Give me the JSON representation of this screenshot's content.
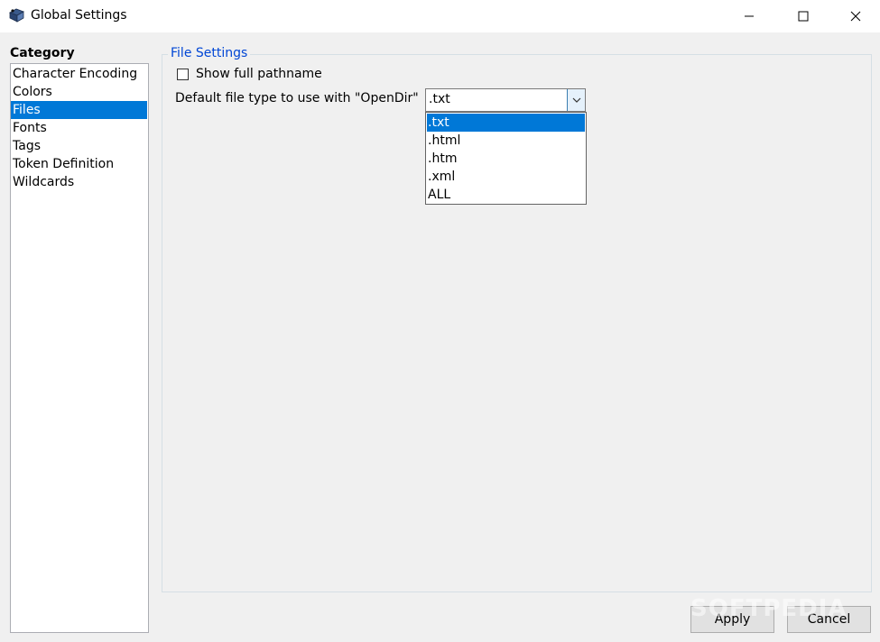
{
  "window": {
    "title": "Global Settings",
    "icon": "notebook-app-icon",
    "controls": [
      "minimize-icon",
      "maximize-icon",
      "close-icon"
    ]
  },
  "sidebar": {
    "heading": "Category",
    "items": [
      {
        "label": "Character Encoding",
        "selected": false
      },
      {
        "label": "Colors",
        "selected": false
      },
      {
        "label": "Files",
        "selected": true
      },
      {
        "label": "Fonts",
        "selected": false
      },
      {
        "label": "Tags",
        "selected": false
      },
      {
        "label": "Token Definition",
        "selected": false
      },
      {
        "label": "Wildcards",
        "selected": false
      }
    ]
  },
  "file_settings": {
    "title": "File Settings",
    "show_full_pathname": {
      "label": "Show full pathname",
      "checked": false
    },
    "default_file_type": {
      "label": "Default file type to use with \"OpenDir\"",
      "value": ".txt",
      "options": [
        ".txt",
        ".html",
        ".htm",
        ".xml",
        "ALL"
      ],
      "highlighted_option": ".txt"
    }
  },
  "buttons": {
    "apply": "Apply",
    "cancel": "Cancel"
  },
  "watermark": "SOFTPEDIA",
  "colors": {
    "selection": "#0078d7",
    "group_title": "#0046d5",
    "background": "#f0f0f0"
  }
}
